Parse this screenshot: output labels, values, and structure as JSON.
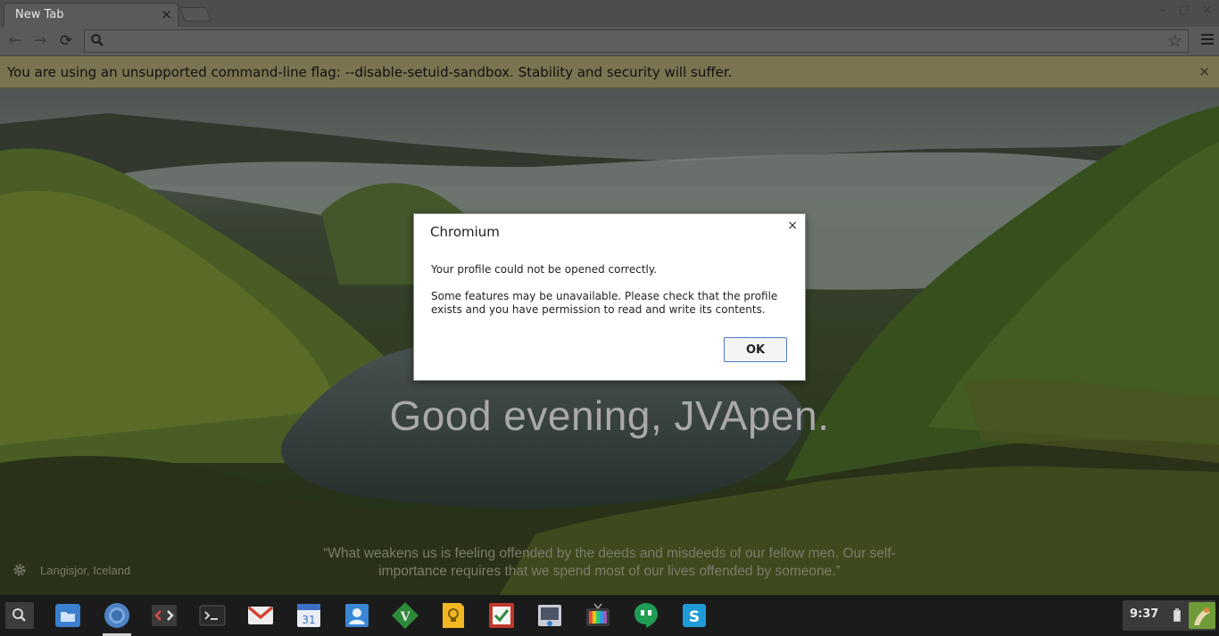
{
  "tab": {
    "title": "New Tab",
    "close": "×"
  },
  "window": {
    "minimize": "–",
    "maximize": "▢",
    "close": "×"
  },
  "omnibox": {
    "value": "",
    "placeholder": ""
  },
  "infobar": {
    "message": "You are using an unsupported command-line flag: --disable-setuid-sandbox. Stability and security will suffer.",
    "close": "×"
  },
  "ntp": {
    "greeting": "Good evening, JVApen.",
    "quote": "“What weakens us is feeling offended by the deeds and misdeeds of our fellow men. Our self-importance requires that we spend most of our lives offended by someone.”",
    "location": "Langisjor, Iceland"
  },
  "dialog": {
    "title": "Chromium",
    "close": "×",
    "message1": "Your profile could not be opened correctly.",
    "message2": "Some features may be unavailable.  Please check that the profile exists and you have permission to read and write its contents.",
    "ok": "OK"
  },
  "shelf": {
    "calendar_day": "31",
    "clock": "9:37",
    "apps": [
      "files",
      "chromium",
      "code-editor",
      "terminal",
      "gmail",
      "calendar",
      "contacts",
      "vim",
      "keep",
      "tasks",
      "screen-recorder",
      "tv",
      "hangouts",
      "skype"
    ]
  },
  "colors": {
    "infobar_bg": "#7a7450",
    "ok_border": "#4d78c9",
    "shelf_bg": "#1b1b1b"
  }
}
